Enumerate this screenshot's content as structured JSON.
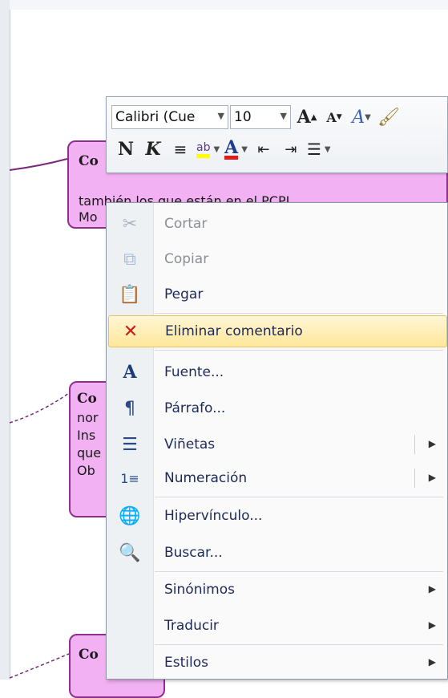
{
  "comments": [
    {
      "lines": [
        "Co",
        "también los que están en el PCPI",
        "Mo"
      ]
    },
    {
      "lines": [
        "Co",
        "nor",
        "Ins",
        "que",
        "Ob"
      ]
    },
    {
      "lines": [
        "Co"
      ]
    }
  ],
  "mini_toolbar": {
    "font_name": "Calibri (Cue",
    "font_size": "10",
    "grow_font": "A",
    "shrink_font": "A",
    "bold": "N",
    "italic": "K",
    "font_color_glyph": "A"
  },
  "context_menu": {
    "items": [
      {
        "label": "Cortar",
        "icon": "scissors-icon",
        "enabled": false,
        "submenu": false
      },
      {
        "label": "Copiar",
        "icon": "copy-icon",
        "enabled": false,
        "submenu": false
      },
      {
        "label": "Pegar",
        "icon": "paste-icon",
        "enabled": true,
        "submenu": false
      },
      {
        "label": "Eliminar comentario",
        "icon": "delete-comment-icon",
        "enabled": true,
        "submenu": false,
        "highlighted": true
      },
      {
        "label": "Fuente...",
        "icon": "font-icon",
        "enabled": true,
        "submenu": false
      },
      {
        "label": "Párrafo...",
        "icon": "paragraph-icon",
        "enabled": true,
        "submenu": false
      },
      {
        "label": "Viñetas",
        "icon": "bullets-icon",
        "enabled": true,
        "submenu": true,
        "split": true
      },
      {
        "label": "Numeración",
        "icon": "numbering-icon",
        "enabled": true,
        "submenu": true,
        "split": true
      },
      {
        "label": "Hipervínculo...",
        "icon": "hyperlink-icon",
        "enabled": true,
        "submenu": false
      },
      {
        "label": "Buscar...",
        "icon": "research-icon",
        "enabled": true,
        "submenu": false
      },
      {
        "label": "Sinónimos",
        "icon": "",
        "enabled": true,
        "submenu": true
      },
      {
        "label": "Traducir",
        "icon": "",
        "enabled": true,
        "submenu": true
      },
      {
        "label": "Estilos",
        "icon": "",
        "enabled": true,
        "submenu": true
      }
    ]
  },
  "colors": {
    "comment_fill": "#f2b1f2",
    "comment_border": "#8e2f8e",
    "highlight": "#ffe79a",
    "font_color_bar": "#e01b1b",
    "highlight_bar": "#ffff00"
  }
}
